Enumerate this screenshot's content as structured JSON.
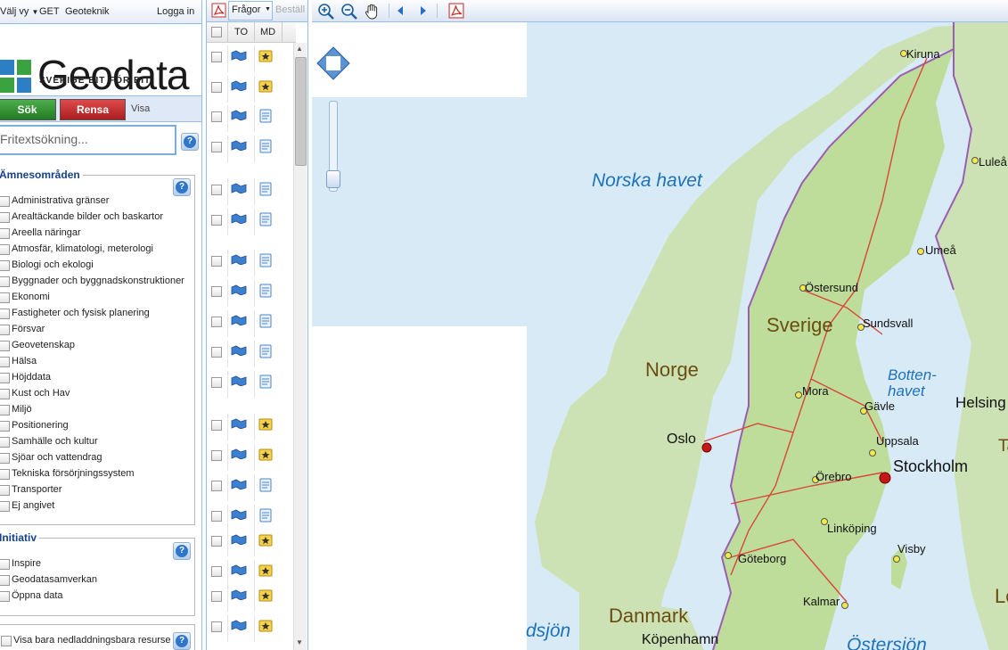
{
  "topbar": {
    "view_label": "Välj vy",
    "get_label": "GET",
    "geoteknik_label": "Geoteknik",
    "login_label": "Logga in"
  },
  "logo": {
    "brand": "Geodata",
    "tagline": "SVERIGE BIT FÖR BIT"
  },
  "actions": {
    "search_label": "Sök",
    "clear_label": "Rensa",
    "show_label": "Visa"
  },
  "search": {
    "placeholder": "Fritextsökning...",
    "help": "?"
  },
  "subjects": {
    "title": "Ämnesområden",
    "items": [
      "Administrativa gränser",
      "Arealtäckande bilder och baskartor",
      "Areella näringar",
      "Atmosfär, klimatologi, meterologi",
      "Biologi och ekologi",
      "Byggnader och byggnadskonstruktioner",
      "Ekonomi",
      "Fastigheter och fysisk planering",
      "Försvar",
      "Geovetenskap",
      "Hälsa",
      "Höjddata",
      "Kust och Hav",
      "Miljö",
      "Positionering",
      "Samhälle och kultur",
      "Sjöar och vattendrag",
      "Tekniska försörjningssystem",
      "Transporter",
      "Ej angivet"
    ]
  },
  "initiatives": {
    "title": "Initiativ",
    "items": [
      "Inspire",
      "Geodatasamverkan",
      "Öppna data"
    ]
  },
  "downloadable": {
    "label": "Visa bara nedladdningsbara resurser"
  },
  "results_toolbar": {
    "queries_label": "Frågor",
    "order_label": "Beställ"
  },
  "results_header": {
    "to": "TO",
    "md": "MD"
  },
  "results_rows": [
    "star",
    "star",
    "doc",
    "doc",
    "doc",
    "doc",
    "doc",
    "doc",
    "doc",
    "doc",
    "doc",
    "star",
    "star",
    "doc",
    "doc",
    "star",
    "star",
    "star",
    "star"
  ],
  "map_labels": {
    "cities": [
      "Kiruna",
      "Luleå",
      "Umeå",
      "Östersund",
      "Sundsvall",
      "Mora",
      "Gävle",
      "Uppsala",
      "Oslo",
      "Stockholm",
      "Örebro",
      "Linköping",
      "Visby",
      "Göteborg",
      "Kalmar",
      "Köpenhamn",
      "Helsing"
    ],
    "countries": [
      "Sverige",
      "Norge",
      "Danmark",
      "Ta",
      "Le"
    ],
    "seas": [
      "Norska havet",
      "Botten-",
      "havet",
      "dsjön",
      "Östersjön"
    ]
  },
  "colors": {
    "sea": "#d7eaf6",
    "land": "#cde2b4",
    "sweden": "#bedc9a",
    "road": "#d9463a",
    "border": "#9b5fb0",
    "sok": "#2f8f2f",
    "rensa": "#c22a2a"
  }
}
